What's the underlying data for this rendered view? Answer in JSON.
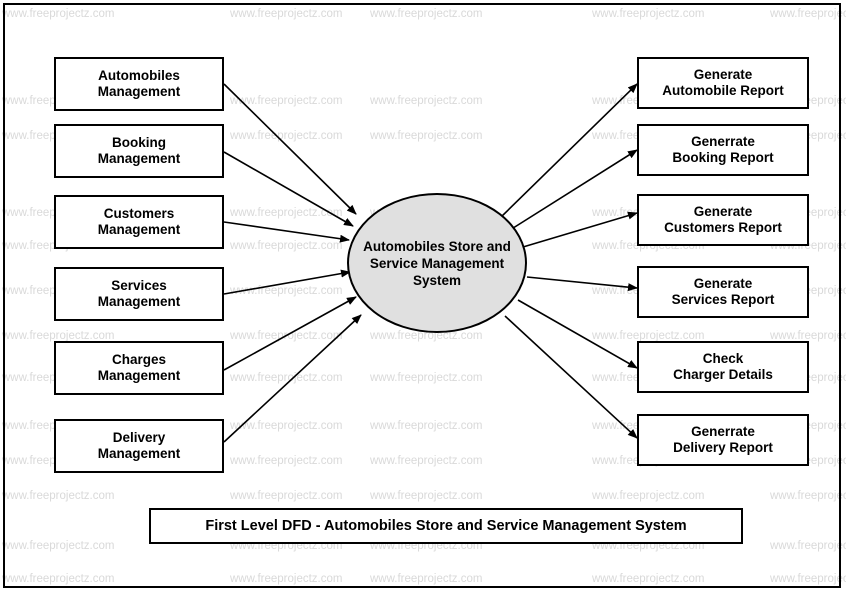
{
  "diagram": {
    "title": "First Level DFD - Automobiles Store and Service Management System",
    "process": "Automobiles Store and Service Management System",
    "left_nodes": [
      {
        "line1": "Automobiles",
        "line2": "Management"
      },
      {
        "line1": "Booking",
        "line2": "Management"
      },
      {
        "line1": "Customers",
        "line2": "Management"
      },
      {
        "line1": "Services",
        "line2": "Management"
      },
      {
        "line1": "Charges",
        "line2": "Management"
      },
      {
        "line1": "Delivery",
        "line2": "Management"
      }
    ],
    "right_nodes": [
      {
        "line1": "Generate",
        "line2": "Automobile Report"
      },
      {
        "line1": "Generrate",
        "line2": "Booking Report"
      },
      {
        "line1": "Generate",
        "line2": "Customers Report"
      },
      {
        "line1": "Generate",
        "line2": "Services Report"
      },
      {
        "line1": "Check",
        "line2": "Charger Details"
      },
      {
        "line1": "Generrate",
        "line2": "Delivery Report"
      }
    ]
  },
  "watermark": {
    "text": "www.freeprojectz.com",
    "short": "www.freeprojec",
    "color": "#d9d9d9"
  }
}
